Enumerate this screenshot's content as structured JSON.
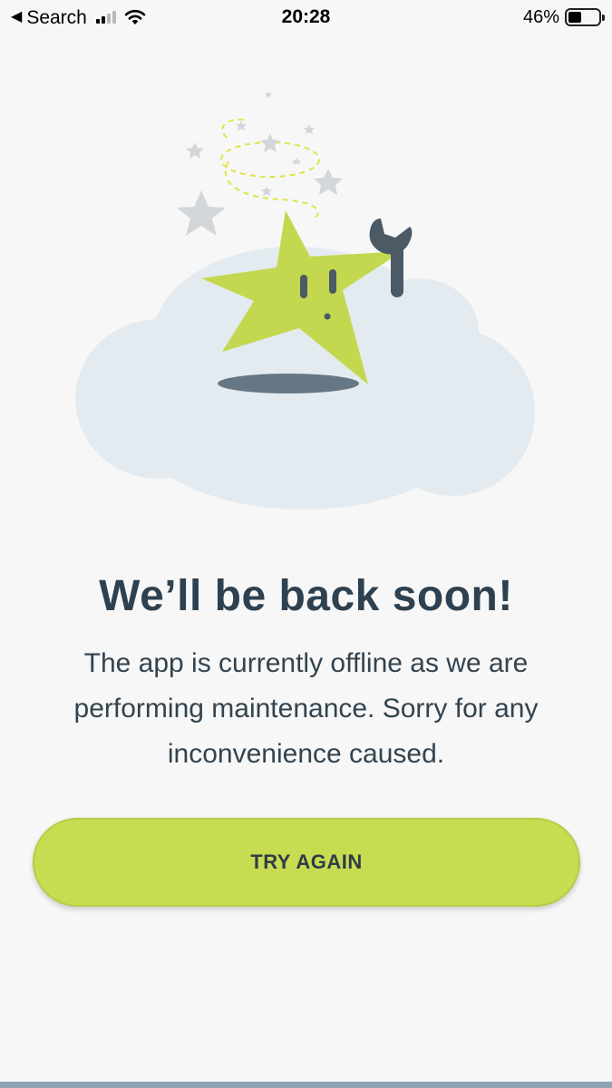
{
  "status_bar": {
    "back_label": "Search",
    "time": "20:28",
    "battery_percent": "46%",
    "battery_level": 0.46
  },
  "illustration": {
    "subject": "star-mascot-with-wrench-on-cloud",
    "colors": {
      "star": "#c3d84f",
      "cloud": "#e3ebf0",
      "wrench": "#4c5a66",
      "sparkle": "#d5d9dc"
    }
  },
  "main": {
    "headline": "We’ll be back soon!",
    "message": "The app is currently offline as we are performing maintenance. Sorry for any inconvenience caused.",
    "button_label": "TRY AGAIN"
  },
  "colors": {
    "background": "#f7f7f7",
    "text_dark": "#2e4150",
    "button_bg": "#c8dc52",
    "bottom_strip": "#8ea3b3"
  }
}
